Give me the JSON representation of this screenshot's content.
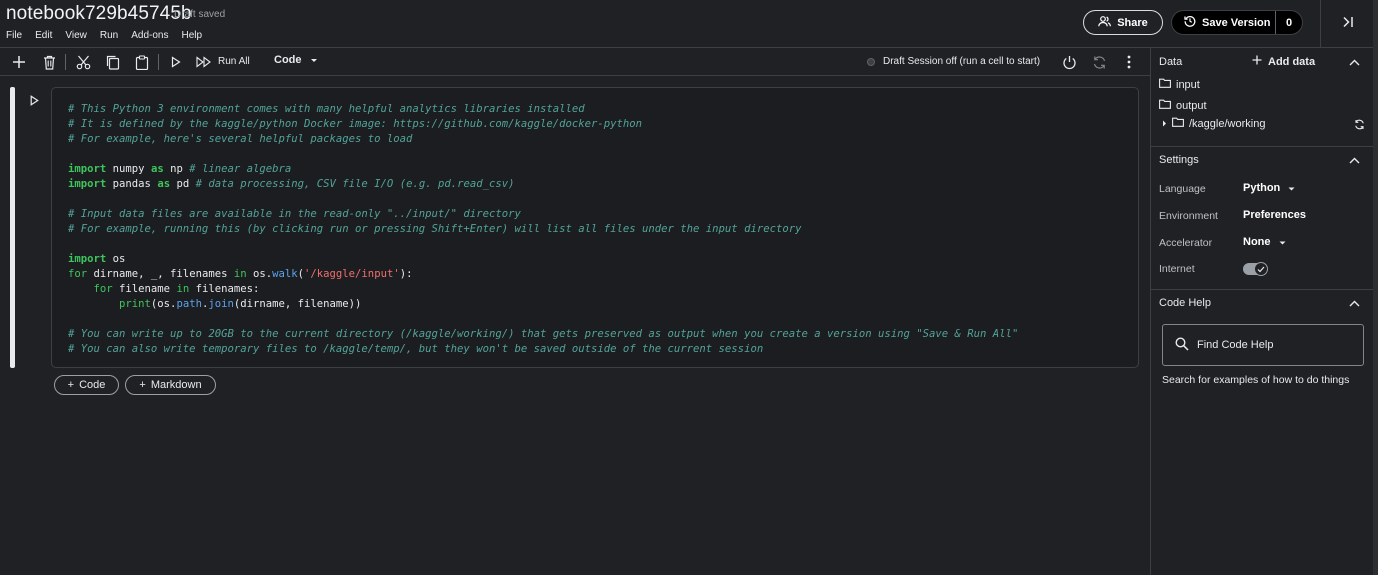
{
  "header": {
    "title": "notebook729b45745b",
    "draft_status": "Draft saved",
    "menu": [
      "File",
      "Edit",
      "View",
      "Run",
      "Add-ons",
      "Help"
    ],
    "share_label": "Share",
    "save_version_label": "Save Version",
    "save_version_count": "0"
  },
  "toolbar": {
    "run_all_label": "Run All",
    "cell_type": "Code",
    "session_status": "Draft Session off (run a cell to start)"
  },
  "cell": {
    "lines": [
      [
        [
          "cm",
          "# This Python 3 environment comes with many helpful analytics libraries installed"
        ]
      ],
      [
        [
          "cm",
          "# It is defined by the kaggle/python Docker image: https://github.com/kaggle/docker-python"
        ]
      ],
      [
        [
          "cm",
          "# For example, here's several helpful packages to load"
        ]
      ],
      [],
      [
        [
          "kw",
          "import"
        ],
        [
          "",
          " numpy "
        ],
        [
          "kw",
          "as"
        ],
        [
          "",
          " np "
        ],
        [
          "cm",
          "# linear algebra"
        ]
      ],
      [
        [
          "kw",
          "import"
        ],
        [
          "",
          " pandas "
        ],
        [
          "kw",
          "as"
        ],
        [
          "",
          " pd "
        ],
        [
          "cm",
          "# data processing, CSV file I/O (e.g. pd.read_csv)"
        ]
      ],
      [],
      [
        [
          "cm",
          "# Input data files are available in the read-only \"../input/\" directory"
        ]
      ],
      [
        [
          "cm",
          "# For example, running this (by clicking run or pressing Shift+Enter) will list all files under the input directory"
        ]
      ],
      [],
      [
        [
          "kw",
          "import"
        ],
        [
          "",
          " os"
        ]
      ],
      [
        [
          "kw2",
          "for"
        ],
        [
          "",
          " dirname, _, filenames "
        ],
        [
          "kw2",
          "in"
        ],
        [
          "",
          " os."
        ],
        [
          "fn",
          "walk"
        ],
        [
          "",
          "("
        ],
        [
          "st",
          "'/kaggle/input'"
        ],
        [
          "",
          "):"
        ]
      ],
      [
        [
          "",
          "    "
        ],
        [
          "kw2",
          "for"
        ],
        [
          "",
          " filename "
        ],
        [
          "kw2",
          "in"
        ],
        [
          "",
          " filenames:"
        ]
      ],
      [
        [
          "",
          "        "
        ],
        [
          "bi",
          "print"
        ],
        [
          "",
          "(os."
        ],
        [
          "fn",
          "path"
        ],
        [
          "",
          "."
        ],
        [
          "fn",
          "join"
        ],
        [
          "",
          "(dirname, filename))"
        ]
      ],
      [],
      [
        [
          "cm",
          "# You can write up to 20GB to the current directory (/kaggle/working/) that gets preserved as output when you create a version using \"Save & Run All\""
        ]
      ],
      [
        [
          "cm",
          "# You can also write temporary files to /kaggle/temp/, but they won't be saved outside of the current session"
        ]
      ]
    ]
  },
  "add_buttons": {
    "code_label": "Code",
    "markdown_label": "Markdown"
  },
  "sidebar": {
    "data": {
      "title": "Data",
      "add_label": "Add data",
      "items": [
        "input",
        "output",
        "/kaggle/working"
      ]
    },
    "settings": {
      "title": "Settings",
      "language_label": "Language",
      "language_value": "Python",
      "environment_label": "Environment",
      "environment_value": "Preferences",
      "accelerator_label": "Accelerator",
      "accelerator_value": "None",
      "internet_label": "Internet",
      "internet_on": true
    },
    "code_help": {
      "title": "Code Help",
      "search_label": "Find Code Help",
      "description": "Search for examples of how to do things"
    }
  }
}
